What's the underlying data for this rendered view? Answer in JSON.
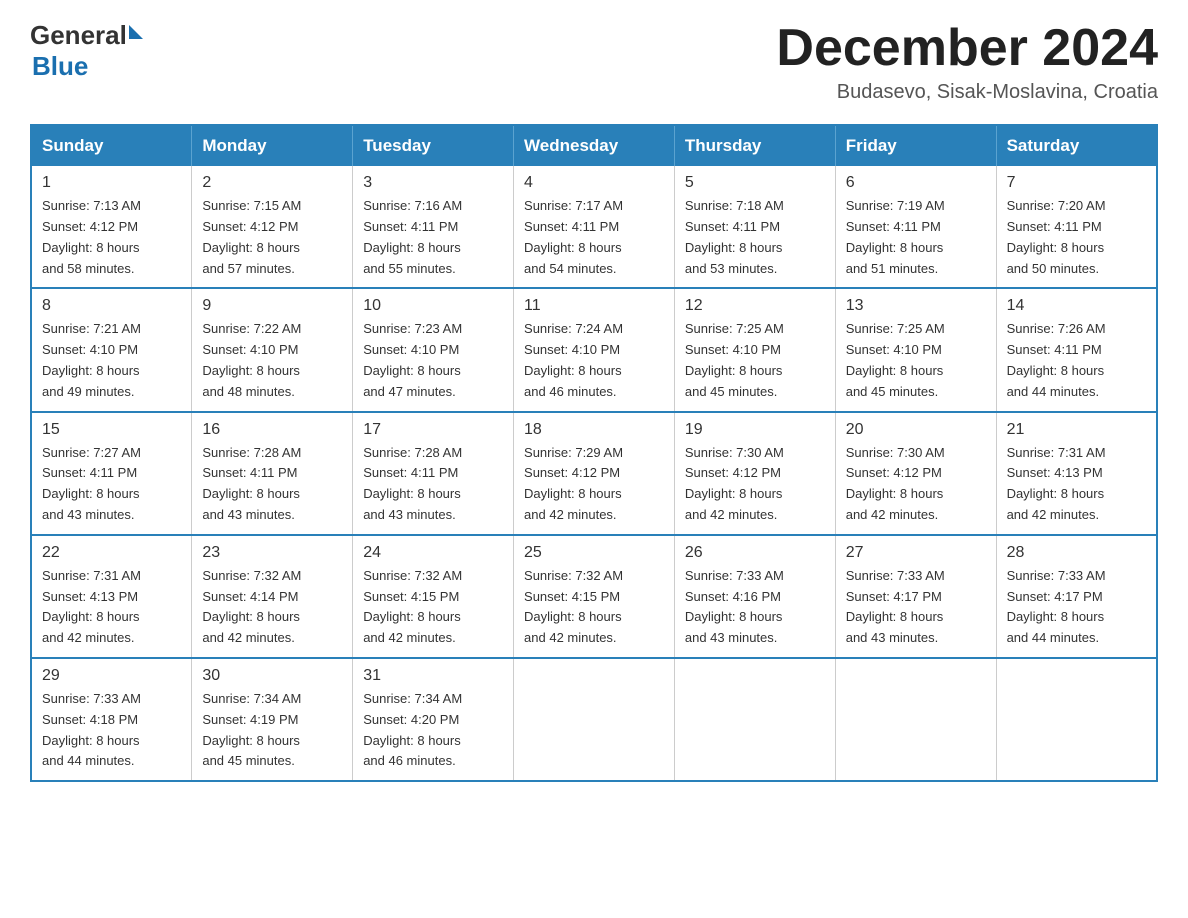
{
  "header": {
    "logo_general": "General",
    "logo_blue": "Blue",
    "month_title": "December 2024",
    "location": "Budasevo, Sisak-Moslavina, Croatia"
  },
  "days_of_week": [
    "Sunday",
    "Monday",
    "Tuesday",
    "Wednesday",
    "Thursday",
    "Friday",
    "Saturday"
  ],
  "weeks": [
    [
      {
        "day": "1",
        "sunrise": "7:13 AM",
        "sunset": "4:12 PM",
        "daylight": "8 hours and 58 minutes."
      },
      {
        "day": "2",
        "sunrise": "7:15 AM",
        "sunset": "4:12 PM",
        "daylight": "8 hours and 57 minutes."
      },
      {
        "day": "3",
        "sunrise": "7:16 AM",
        "sunset": "4:11 PM",
        "daylight": "8 hours and 55 minutes."
      },
      {
        "day": "4",
        "sunrise": "7:17 AM",
        "sunset": "4:11 PM",
        "daylight": "8 hours and 54 minutes."
      },
      {
        "day": "5",
        "sunrise": "7:18 AM",
        "sunset": "4:11 PM",
        "daylight": "8 hours and 53 minutes."
      },
      {
        "day": "6",
        "sunrise": "7:19 AM",
        "sunset": "4:11 PM",
        "daylight": "8 hours and 51 minutes."
      },
      {
        "day": "7",
        "sunrise": "7:20 AM",
        "sunset": "4:11 PM",
        "daylight": "8 hours and 50 minutes."
      }
    ],
    [
      {
        "day": "8",
        "sunrise": "7:21 AM",
        "sunset": "4:10 PM",
        "daylight": "8 hours and 49 minutes."
      },
      {
        "day": "9",
        "sunrise": "7:22 AM",
        "sunset": "4:10 PM",
        "daylight": "8 hours and 48 minutes."
      },
      {
        "day": "10",
        "sunrise": "7:23 AM",
        "sunset": "4:10 PM",
        "daylight": "8 hours and 47 minutes."
      },
      {
        "day": "11",
        "sunrise": "7:24 AM",
        "sunset": "4:10 PM",
        "daylight": "8 hours and 46 minutes."
      },
      {
        "day": "12",
        "sunrise": "7:25 AM",
        "sunset": "4:10 PM",
        "daylight": "8 hours and 45 minutes."
      },
      {
        "day": "13",
        "sunrise": "7:25 AM",
        "sunset": "4:10 PM",
        "daylight": "8 hours and 45 minutes."
      },
      {
        "day": "14",
        "sunrise": "7:26 AM",
        "sunset": "4:11 PM",
        "daylight": "8 hours and 44 minutes."
      }
    ],
    [
      {
        "day": "15",
        "sunrise": "7:27 AM",
        "sunset": "4:11 PM",
        "daylight": "8 hours and 43 minutes."
      },
      {
        "day": "16",
        "sunrise": "7:28 AM",
        "sunset": "4:11 PM",
        "daylight": "8 hours and 43 minutes."
      },
      {
        "day": "17",
        "sunrise": "7:28 AM",
        "sunset": "4:11 PM",
        "daylight": "8 hours and 43 minutes."
      },
      {
        "day": "18",
        "sunrise": "7:29 AM",
        "sunset": "4:12 PM",
        "daylight": "8 hours and 42 minutes."
      },
      {
        "day": "19",
        "sunrise": "7:30 AM",
        "sunset": "4:12 PM",
        "daylight": "8 hours and 42 minutes."
      },
      {
        "day": "20",
        "sunrise": "7:30 AM",
        "sunset": "4:12 PM",
        "daylight": "8 hours and 42 minutes."
      },
      {
        "day": "21",
        "sunrise": "7:31 AM",
        "sunset": "4:13 PM",
        "daylight": "8 hours and 42 minutes."
      }
    ],
    [
      {
        "day": "22",
        "sunrise": "7:31 AM",
        "sunset": "4:13 PM",
        "daylight": "8 hours and 42 minutes."
      },
      {
        "day": "23",
        "sunrise": "7:32 AM",
        "sunset": "4:14 PM",
        "daylight": "8 hours and 42 minutes."
      },
      {
        "day": "24",
        "sunrise": "7:32 AM",
        "sunset": "4:15 PM",
        "daylight": "8 hours and 42 minutes."
      },
      {
        "day": "25",
        "sunrise": "7:32 AM",
        "sunset": "4:15 PM",
        "daylight": "8 hours and 42 minutes."
      },
      {
        "day": "26",
        "sunrise": "7:33 AM",
        "sunset": "4:16 PM",
        "daylight": "8 hours and 43 minutes."
      },
      {
        "day": "27",
        "sunrise": "7:33 AM",
        "sunset": "4:17 PM",
        "daylight": "8 hours and 43 minutes."
      },
      {
        "day": "28",
        "sunrise": "7:33 AM",
        "sunset": "4:17 PM",
        "daylight": "8 hours and 44 minutes."
      }
    ],
    [
      {
        "day": "29",
        "sunrise": "7:33 AM",
        "sunset": "4:18 PM",
        "daylight": "8 hours and 44 minutes."
      },
      {
        "day": "30",
        "sunrise": "7:34 AM",
        "sunset": "4:19 PM",
        "daylight": "8 hours and 45 minutes."
      },
      {
        "day": "31",
        "sunrise": "7:34 AM",
        "sunset": "4:20 PM",
        "daylight": "8 hours and 46 minutes."
      },
      null,
      null,
      null,
      null
    ]
  ],
  "labels": {
    "sunrise": "Sunrise:",
    "sunset": "Sunset:",
    "daylight": "Daylight:"
  }
}
